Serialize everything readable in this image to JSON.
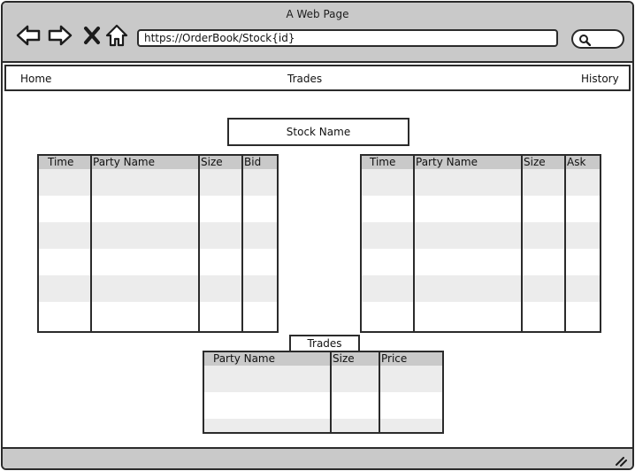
{
  "window": {
    "title": "A Web Page"
  },
  "browser": {
    "url": "https://OrderBook/Stock{id}",
    "icons": [
      "back-icon",
      "forward-icon",
      "close-icon",
      "home-icon",
      "search-icon"
    ]
  },
  "nav": {
    "home": "Home",
    "trades": "Trades",
    "history": "History"
  },
  "stock": {
    "name": "Stock Name"
  },
  "bids_table": {
    "columns": [
      "Time",
      "Party Name",
      "Size",
      "Bid"
    ]
  },
  "asks_table": {
    "columns": [
      "Time",
      "Party Name",
      "Size",
      "Ask"
    ]
  },
  "trades_section": {
    "label": "Trades",
    "columns": [
      "Party Name",
      "Size",
      "Price"
    ]
  },
  "colors": {
    "chrome": "#c9c9c9",
    "header": "#c9c9c9",
    "stripe": "#ececec",
    "border": "#2b2b2b"
  }
}
